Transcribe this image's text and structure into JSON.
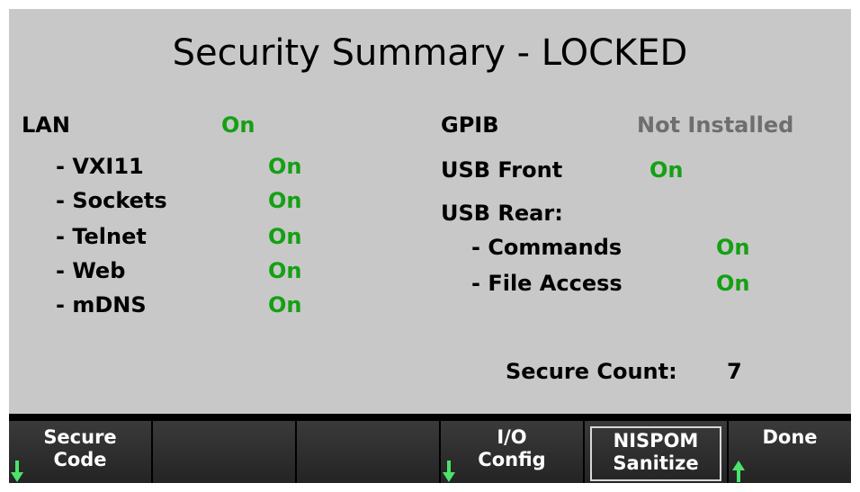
{
  "screen": {
    "title": "Security Summary - LOCKED"
  },
  "lan": {
    "label": "LAN",
    "value": "On",
    "items": [
      {
        "label": "- VXI11",
        "value": "On"
      },
      {
        "label": "- Sockets",
        "value": "On"
      },
      {
        "label": "- Telnet",
        "value": "On"
      },
      {
        "label": "- Web",
        "value": "On"
      },
      {
        "label": "- mDNS",
        "value": "On"
      }
    ]
  },
  "gpib": {
    "label": "GPIB",
    "value": "Not Installed"
  },
  "usb_front": {
    "label": "USB Front",
    "value": "On"
  },
  "usb_rear": {
    "label": "USB Rear:",
    "items": [
      {
        "label": "- Commands",
        "value": "On"
      },
      {
        "label": "- File Access",
        "value": "On"
      }
    ]
  },
  "secure_count": {
    "label": "Secure Count:",
    "value": "7"
  },
  "softkeys": [
    {
      "label": "Secure\nCode",
      "arrow": "down-arrow-icon"
    },
    {
      "label": ""
    },
    {
      "label": ""
    },
    {
      "label": "I/O\nConfig",
      "arrow": "down-arrow-icon"
    },
    {
      "label": "NISPOM\nSanitize"
    },
    {
      "label": "Done",
      "arrow": "up-arrow-icon"
    }
  ],
  "colors": {
    "on": "#14a014",
    "not_installed": "#6e6e6e",
    "screen_bg": "#c8c8c8",
    "softkey_bg": "#2e2e2e",
    "arrow": "#4be36a"
  }
}
